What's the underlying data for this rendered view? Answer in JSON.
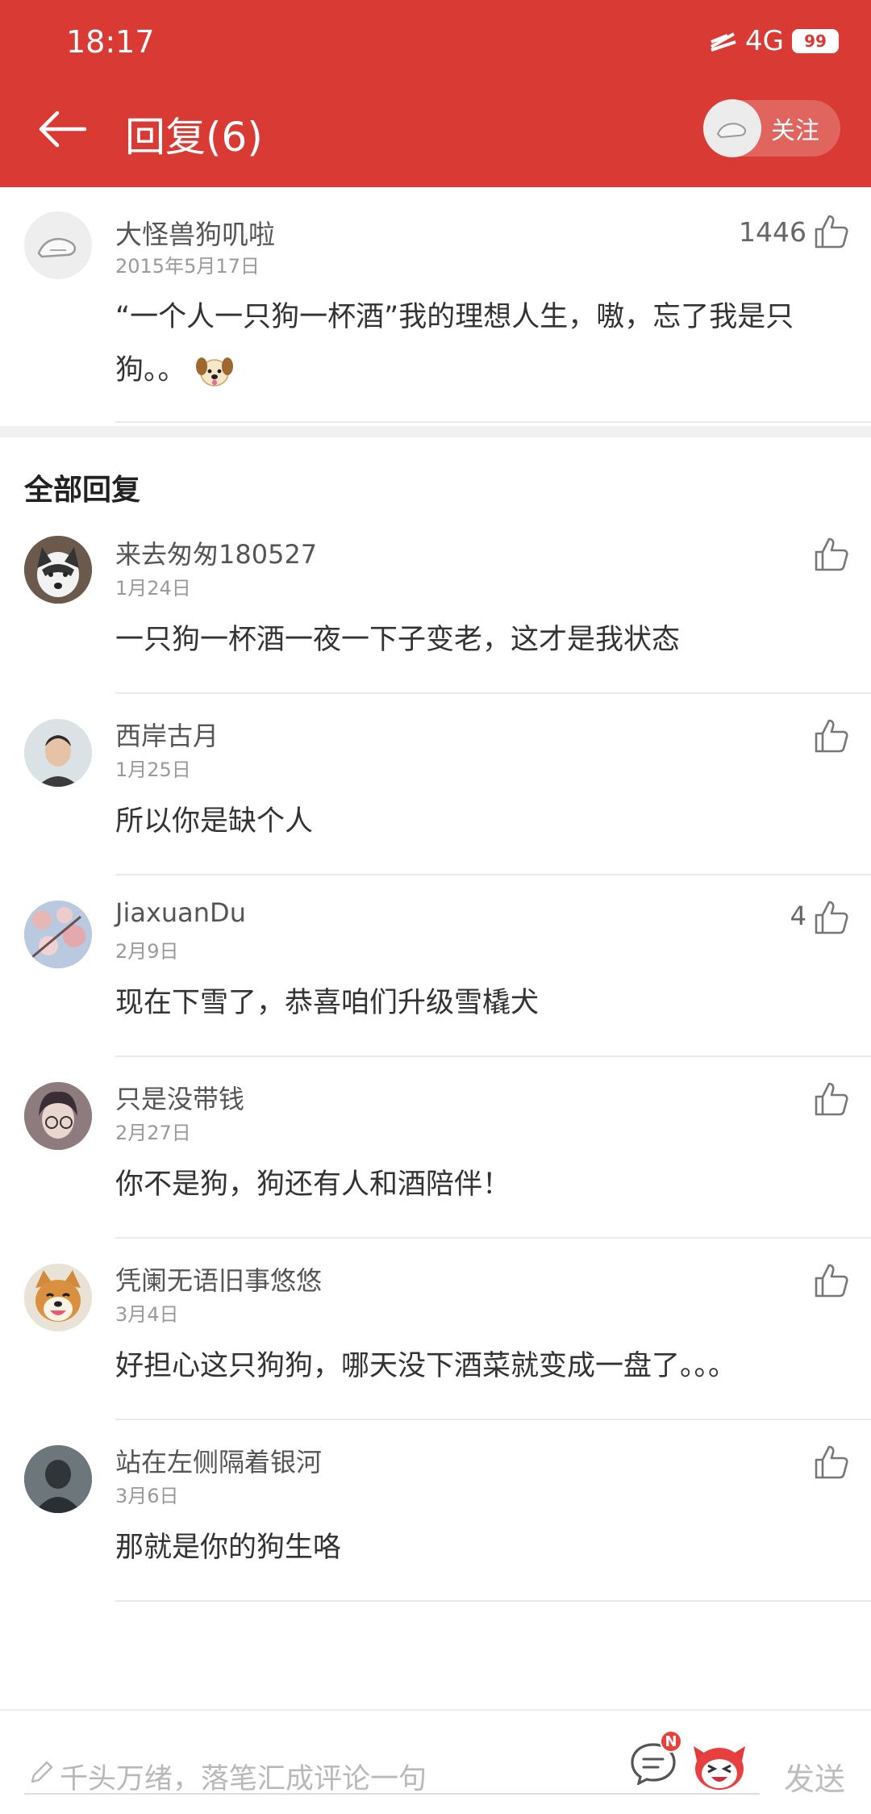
{
  "status_bar": {
    "time": "18:17",
    "network": "4G",
    "battery": "99"
  },
  "header": {
    "title": "回复(6)",
    "follow_label": "关注"
  },
  "main_comment": {
    "user": "大怪兽狗叽啦",
    "date": "2015年5月17日",
    "likes": "1446",
    "text": "“一个人一只狗一杯酒”我的理想人生，嗷，忘了我是只狗。。"
  },
  "section_title": "全部回复",
  "replies": [
    {
      "user": "来去匆匆180527",
      "date": "1月24日",
      "text": "一只狗一杯酒一夜一下子变老，这才是我状态",
      "likes": ""
    },
    {
      "user": "西岸古月",
      "date": "1月25日",
      "text": "所以你是缺个人",
      "likes": ""
    },
    {
      "user": "JiaxuanDu",
      "date": "2月9日",
      "text": "现在下雪了，恭喜咱们升级雪橇犬",
      "likes": "4"
    },
    {
      "user": "只是没带钱",
      "date": "2月27日",
      "text": "你不是狗，狗还有人和酒陪伴！",
      "likes": ""
    },
    {
      "user": "凭阑无语旧事悠悠",
      "date": "3月4日",
      "text": "好担心这只狗狗，哪天没下酒菜就变成一盘了。。。",
      "likes": ""
    },
    {
      "user": "站在左侧隔着银河",
      "date": "3月6日",
      "text": "那就是你的狗生咯",
      "likes": ""
    }
  ],
  "bottom_bar": {
    "placeholder": "千头万绪，落笔汇成评论一句",
    "badge": "N",
    "send_label": "发送"
  },
  "colors": {
    "header_bg": "#d93a33",
    "badge": "#e8413a",
    "text_main": "#333333",
    "text_muted": "#999999"
  }
}
